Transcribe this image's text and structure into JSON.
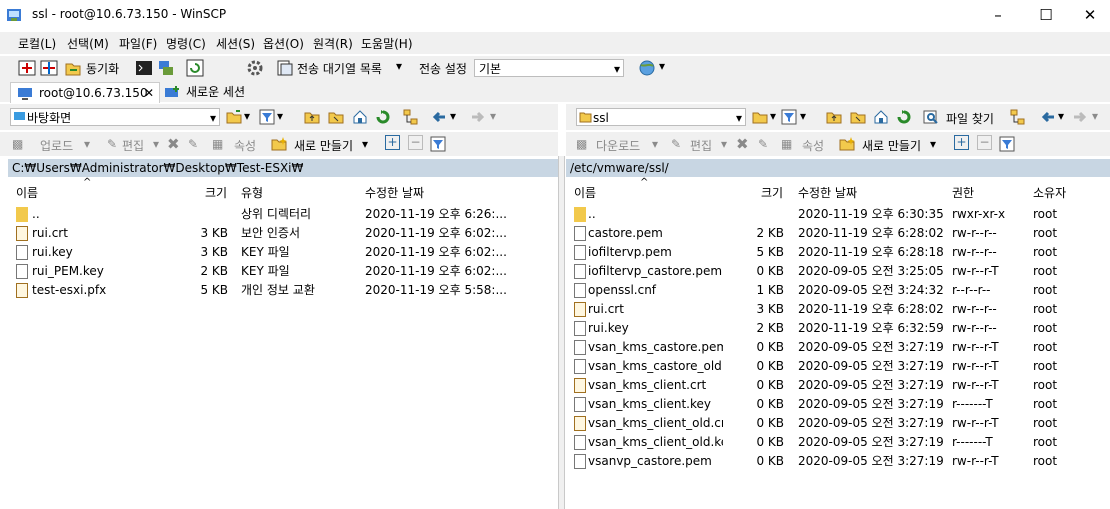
{
  "window": {
    "title": "ssl - root@10.6.73.150 - WinSCP"
  },
  "menu": [
    "로컬(L)",
    "선택(M)",
    "파일(F)",
    "명령(C)",
    "세션(S)",
    "옵션(O)",
    "원격(R)",
    "도움말(H)"
  ],
  "toolbar": {
    "sync_label": "동기화",
    "queue_label": "전송 대기열 목록",
    "transfer_label": "전송 설정",
    "transfer_value": "기본"
  },
  "tabs": {
    "session": "root@10.6.73.150",
    "new_session": "새로운 세션"
  },
  "left": {
    "location": "바탕화면",
    "upload": "업로드",
    "edit": "편집",
    "props": "속성",
    "new": "새로 만들기",
    "path": "C:₩Users₩Administrator₩Desktop₩Test-ESXi₩",
    "headers": {
      "name": "이름",
      "size": "크기",
      "type": "유형",
      "modified": "수정한 날짜"
    },
    "files": [
      {
        "name": "..",
        "size": "",
        "type": "상위 디렉터리",
        "date": "2020-11-19  오후 6:26:...",
        "icon": "up"
      },
      {
        "name": "rui.crt",
        "size": "3 KB",
        "type": "보안 인증서",
        "date": "2020-11-19  오후 6:02:...",
        "icon": "cert"
      },
      {
        "name": "rui.key",
        "size": "3 KB",
        "type": "KEY 파일",
        "date": "2020-11-19  오후 6:02:...",
        "icon": "file"
      },
      {
        "name": "rui_PEM.key",
        "size": "2 KB",
        "type": "KEY 파일",
        "date": "2020-11-19  오후 6:02:...",
        "icon": "file"
      },
      {
        "name": "test-esxi.pfx",
        "size": "5 KB",
        "type": "개인 정보 교환",
        "date": "2020-11-19  오후 5:58:...",
        "icon": "cert"
      }
    ]
  },
  "right": {
    "location": "ssl",
    "find": "파일 찾기",
    "download": "다운로드",
    "edit": "편집",
    "props": "속성",
    "new": "새로 만들기",
    "path": "/etc/vmware/ssl/",
    "headers": {
      "name": "이름",
      "size": "크기",
      "modified": "수정한 날짜",
      "perm": "권한",
      "owner": "소유자"
    },
    "files": [
      {
        "name": "..",
        "size": "",
        "date": "2020-11-19  오후 6:30:35",
        "perm": "rwxr-xr-x",
        "owner": "root",
        "icon": "up"
      },
      {
        "name": "castore.pem",
        "size": "2 KB",
        "date": "2020-11-19  오후 6:28:02",
        "perm": "rw-r--r--",
        "owner": "root",
        "icon": "file"
      },
      {
        "name": "iofiltervp.pem",
        "size": "5 KB",
        "date": "2020-11-19  오후 6:28:18",
        "perm": "rw-r--r--",
        "owner": "root",
        "icon": "file"
      },
      {
        "name": "iofiltervp_castore.pem",
        "size": "0 KB",
        "date": "2020-09-05  오전 3:25:05",
        "perm": "rw-r--r-T",
        "owner": "root",
        "icon": "file"
      },
      {
        "name": "openssl.cnf",
        "size": "1 KB",
        "date": "2020-09-05  오전 3:24:32",
        "perm": "r--r--r--",
        "owner": "root",
        "icon": "file"
      },
      {
        "name": "rui.crt",
        "size": "3 KB",
        "date": "2020-11-19  오후 6:28:02",
        "perm": "rw-r--r--",
        "owner": "root",
        "icon": "cert"
      },
      {
        "name": "rui.key",
        "size": "2 KB",
        "date": "2020-11-19  오후 6:32:59",
        "perm": "rw-r--r--",
        "owner": "root",
        "icon": "file"
      },
      {
        "name": "vsan_kms_castore.pem",
        "size": "0 KB",
        "date": "2020-09-05  오전 3:27:19",
        "perm": "rw-r--r-T",
        "owner": "root",
        "icon": "file"
      },
      {
        "name": "vsan_kms_castore_old....",
        "size": "0 KB",
        "date": "2020-09-05  오전 3:27:19",
        "perm": "rw-r--r-T",
        "owner": "root",
        "icon": "file"
      },
      {
        "name": "vsan_kms_client.crt",
        "size": "0 KB",
        "date": "2020-09-05  오전 3:27:19",
        "perm": "rw-r--r-T",
        "owner": "root",
        "icon": "cert"
      },
      {
        "name": "vsan_kms_client.key",
        "size": "0 KB",
        "date": "2020-09-05  오전 3:27:19",
        "perm": "r-------T",
        "owner": "root",
        "icon": "file"
      },
      {
        "name": "vsan_kms_client_old.crt",
        "size": "0 KB",
        "date": "2020-09-05  오전 3:27:19",
        "perm": "rw-r--r-T",
        "owner": "root",
        "icon": "cert"
      },
      {
        "name": "vsan_kms_client_old.key",
        "size": "0 KB",
        "date": "2020-09-05  오전 3:27:19",
        "perm": "r-------T",
        "owner": "root",
        "icon": "file"
      },
      {
        "name": "vsanvp_castore.pem",
        "size": "0 KB",
        "date": "2020-09-05  오전 3:27:19",
        "perm": "rw-r--r-T",
        "owner": "root",
        "icon": "file"
      }
    ]
  }
}
